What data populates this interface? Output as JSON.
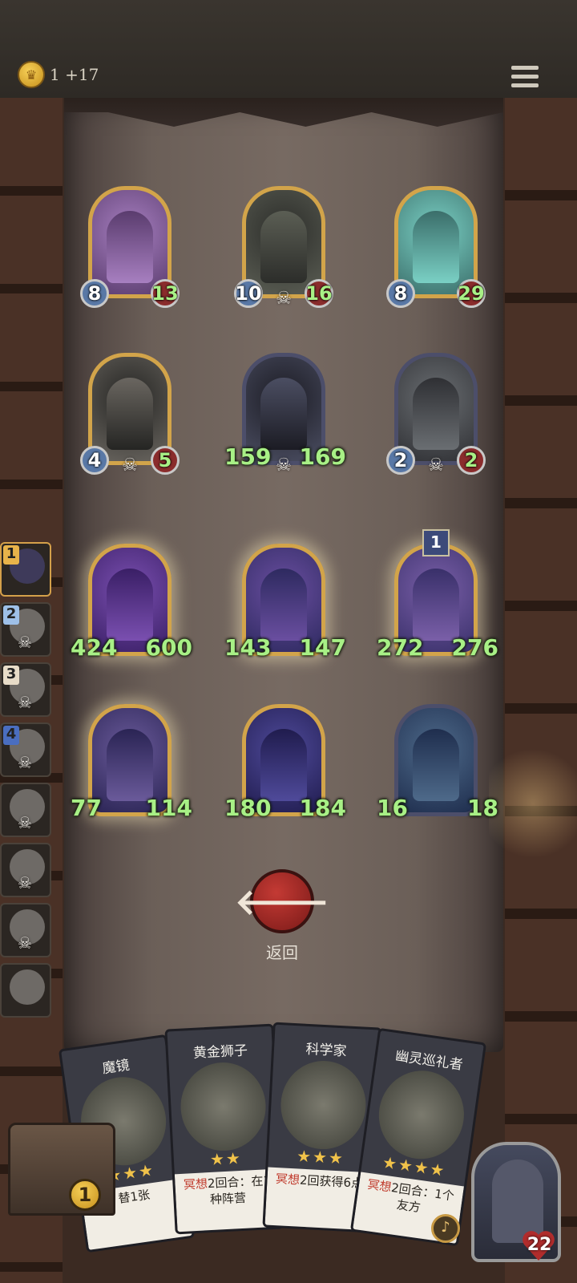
{
  "top_bar": {
    "gold_icon": "crown-coin-icon",
    "gold_text": "1 +17",
    "menu_icon": "hamburger-menu-icon"
  },
  "board": {
    "rows": [
      [
        {
          "attack": "8",
          "health": "13",
          "frame": "gold",
          "skull": false,
          "big": false,
          "tier": ""
        },
        {
          "attack": "10",
          "health": "16",
          "frame": "gold",
          "skull": true,
          "big": false,
          "tier": ""
        },
        {
          "attack": "8",
          "health": "29",
          "frame": "gold",
          "skull": false,
          "big": false,
          "tier": ""
        }
      ],
      [
        {
          "attack": "4",
          "health": "5",
          "frame": "gold",
          "skull": true,
          "big": false,
          "tier": ""
        },
        {
          "attack": "159",
          "health": "169",
          "frame": "dark",
          "skull": true,
          "big": true,
          "tier": ""
        },
        {
          "attack": "2",
          "health": "2",
          "frame": "dark",
          "skull": true,
          "big": false,
          "tier": ""
        }
      ],
      [
        {
          "attack": "424",
          "health": "600",
          "frame": "gold-glow",
          "skull": false,
          "big": true,
          "tier": ""
        },
        {
          "attack": "143",
          "health": "147",
          "frame": "gold-glow",
          "skull": false,
          "big": true,
          "tier": ""
        },
        {
          "attack": "272",
          "health": "276",
          "frame": "gold-glow",
          "skull": false,
          "big": true,
          "tier": "1"
        }
      ],
      [
        {
          "attack": "77",
          "health": "114",
          "frame": "gold-glow",
          "skull": false,
          "big": true,
          "tier": ""
        },
        {
          "attack": "180",
          "health": "184",
          "frame": "gold",
          "skull": false,
          "big": true,
          "tier": ""
        },
        {
          "attack": "16",
          "health": "18",
          "frame": "dark",
          "skull": false,
          "big": true,
          "tier": ""
        }
      ]
    ]
  },
  "sidebar": {
    "players": [
      {
        "rank": "1",
        "active": true,
        "skull": false
      },
      {
        "rank": "2",
        "active": false,
        "skull": true
      },
      {
        "rank": "3",
        "active": false,
        "skull": true
      },
      {
        "rank": "4",
        "active": false,
        "skull": true
      },
      {
        "rank": "",
        "active": false,
        "skull": true
      },
      {
        "rank": "",
        "active": false,
        "skull": true
      },
      {
        "rank": "",
        "active": false,
        "skull": true
      },
      {
        "rank": "",
        "active": false,
        "skull": false
      }
    ]
  },
  "back_button": {
    "icon": "arrow-left-icon",
    "label": "返回"
  },
  "hand": {
    "cards": [
      {
        "name": "魔镜",
        "stars": "★★★",
        "desc_kw": "",
        "desc": "替1张"
      },
      {
        "name": "黄金狮子",
        "stars": "★★",
        "desc_kw": "冥想",
        "desc": "2回合：在1种阵营"
      },
      {
        "name": "科学家",
        "stars": "★★★",
        "desc_kw": "冥想",
        "desc": "2回获得6点"
      },
      {
        "name": "幽灵巡礼者",
        "stars": "★★★★",
        "desc_kw": "冥想",
        "desc": "2回合：1个友方"
      }
    ]
  },
  "bottom": {
    "chest_count": "1",
    "hero_health": "22",
    "emote_icon": "bell-icon"
  },
  "colors": {
    "gold_frame": "#d2a44a",
    "dark_frame": "#4c4e6a",
    "health_green": "#a8f086",
    "back_red": "#c43a34"
  }
}
